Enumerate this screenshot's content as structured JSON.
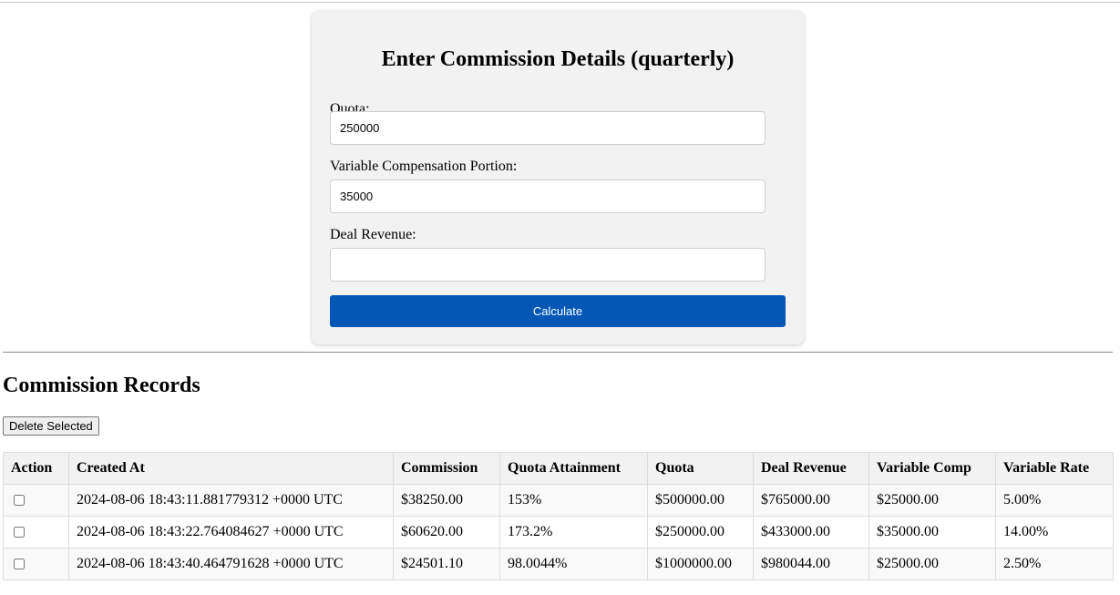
{
  "form": {
    "title": "Enter Commission Details (quarterly)",
    "quota_label": "Quota:",
    "quota_value": "250000",
    "variable_comp_label": "Variable Compensation Portion:",
    "variable_comp_value": "35000",
    "deal_revenue_label": "Deal Revenue:",
    "deal_revenue_value": "",
    "calculate_label": "Calculate"
  },
  "records": {
    "title": "Commission Records",
    "delete_label": "Delete Selected",
    "columns": [
      "Action",
      "Created At",
      "Commission",
      "Quota Attainment",
      "Quota",
      "Deal Revenue",
      "Variable Comp",
      "Variable Rate"
    ],
    "rows": [
      {
        "checked": false,
        "created_at": "2024-08-06 18:43:11.881779312 +0000 UTC",
        "commission": "$38250.00",
        "quota_attainment": "153%",
        "quota": "$500000.00",
        "deal_revenue": "$765000.00",
        "variable_comp": "$25000.00",
        "variable_rate": "5.00%"
      },
      {
        "checked": false,
        "created_at": "2024-08-06 18:43:22.764084627 +0000 UTC",
        "commission": "$60620.00",
        "quota_attainment": "173.2%",
        "quota": "$250000.00",
        "deal_revenue": "$433000.00",
        "variable_comp": "$35000.00",
        "variable_rate": "14.00%"
      },
      {
        "checked": false,
        "created_at": "2024-08-06 18:43:40.464791628 +0000 UTC",
        "commission": "$24501.10",
        "quota_attainment": "98.0044%",
        "quota": "$1000000.00",
        "deal_revenue": "$980044.00",
        "variable_comp": "$25000.00",
        "variable_rate": "2.50%"
      }
    ]
  },
  "colors": {
    "primary_button": "#0457b5",
    "card_background": "#f2f2f2"
  }
}
